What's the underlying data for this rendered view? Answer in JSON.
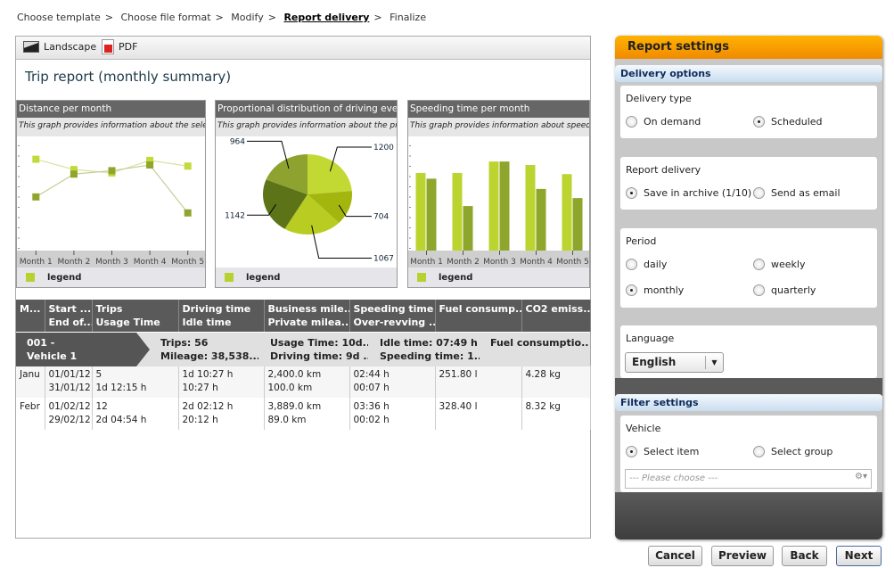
{
  "breadcrumb": [
    "Choose template",
    "Choose file format",
    "Modify",
    "Report delivery",
    "Finalize"
  ],
  "breadcrumb_sep": ">",
  "toolbar": {
    "landscape": "Landscape",
    "pdf": "PDF"
  },
  "report_title": "Trip report (monthly summary)",
  "charts": [
    {
      "title": "Distance per month",
      "subtitle": "This graph provides information about the selected",
      "legend": "legend"
    },
    {
      "title": "Proportional distribution of driving events",
      "subtitle": "This graph provides information about the propor",
      "legend": "legend"
    },
    {
      "title": "Speeding time per month",
      "subtitle": "This graph provides information about speeding t",
      "legend": "legend"
    }
  ],
  "chart_data": [
    {
      "type": "line",
      "title": "Distance per month",
      "categories": [
        "Month 1",
        "Month 2",
        "Month 3",
        "Month 4",
        "Month 5"
      ],
      "ylim": [
        0,
        100
      ],
      "series": [
        {
          "values": [
            80,
            71,
            68,
            79,
            74
          ],
          "color": "#c4da3a"
        },
        {
          "values": [
            47,
            67,
            70,
            75,
            33
          ],
          "color": "#8fa62c"
        }
      ]
    },
    {
      "type": "pie",
      "title": "Proportional distribution of driving events",
      "values": [
        1200,
        704,
        1067,
        1142,
        964
      ],
      "colors": [
        "#c2d934",
        "#a3b60e",
        "#b8cc22",
        "#5c7417",
        "#8ea32f"
      ]
    },
    {
      "type": "bar",
      "title": "Speeding time per month",
      "categories": [
        "Month 1",
        "Month 2",
        "Month 3",
        "Month 4",
        "Month 5"
      ],
      "ylim": [
        0,
        100
      ],
      "series": [
        {
          "values": [
            68,
            68,
            78,
            75,
            67
          ],
          "color": "#bcd430"
        },
        {
          "values": [
            63,
            39,
            78,
            54,
            46
          ],
          "color": "#8fa62c"
        }
      ]
    }
  ],
  "table": {
    "headers": [
      [
        "M..."
      ],
      [
        "Start ...",
        "End of..."
      ],
      [
        "Trips",
        "Usage Time"
      ],
      [
        "Driving time",
        "Idle time"
      ],
      [
        "Business mile...",
        "Private milea..."
      ],
      [
        "Speeding time",
        "Over-revving ..."
      ],
      [
        "Fuel consump..."
      ],
      [
        "CO2 emiss..."
      ]
    ],
    "group": {
      "vehicle": [
        "001 -",
        "Vehicle 1"
      ],
      "summary": [
        [
          "Trips: 56",
          "Mileage: 38,538...."
        ],
        [
          "Usage Time: 10d...",
          "Driving time: 9d ..."
        ],
        [
          "Idle time: 07:49 h",
          "Speeding time: 1..."
        ],
        [
          "Fuel consumptio..."
        ]
      ]
    },
    "rows": [
      [
        [
          "Janu"
        ],
        [
          "01/01/12",
          "31/01/12"
        ],
        [
          "5",
          "1d 12:15 h"
        ],
        [
          "1d 10:27 h",
          "10:27 h"
        ],
        [
          "2,400.0 km",
          "100.0 km"
        ],
        [
          "02:44 h",
          "00:07 h"
        ],
        [
          "251.80 l"
        ],
        [
          "4.28 kg"
        ]
      ],
      [
        [
          "Febr"
        ],
        [
          "01/02/12",
          "29/02/12"
        ],
        [
          "12",
          "2d 04:54 h"
        ],
        [
          "2d 02:12 h",
          "20:12 h"
        ],
        [
          "3,889.0 km",
          "89.0 km"
        ],
        [
          "03:36 h",
          "00:02 h"
        ],
        [
          "328.40 l"
        ],
        [
          "8.32 kg"
        ]
      ]
    ]
  },
  "settings": {
    "title": "Report settings",
    "delivery_options": "Delivery options",
    "delivery_type": {
      "label": "Delivery type",
      "options": [
        "On demand",
        "Scheduled"
      ],
      "selected": "Scheduled"
    },
    "report_delivery": {
      "label": "Report delivery",
      "options": [
        "Save in archive (1/10)",
        "Send as email"
      ],
      "selected": "Save in archive (1/10)"
    },
    "period": {
      "label": "Period",
      "options": [
        "daily",
        "weekly",
        "monthly",
        "quarterly"
      ],
      "selected": "monthly"
    },
    "language": {
      "label": "Language",
      "value": "English"
    },
    "filter_settings": "Filter settings",
    "vehicle": {
      "label": "Vehicle",
      "options": [
        "Select item",
        "Select group"
      ],
      "selected": "Select item",
      "placeholder": "--- Please choose ---"
    }
  },
  "buttons": {
    "cancel": "Cancel",
    "preview": "Preview",
    "back": "Back",
    "next": "Next"
  },
  "colors": {
    "accent": "#f08a00",
    "header_dark": "#5a5a5a",
    "chart_light": "#c2d934"
  }
}
